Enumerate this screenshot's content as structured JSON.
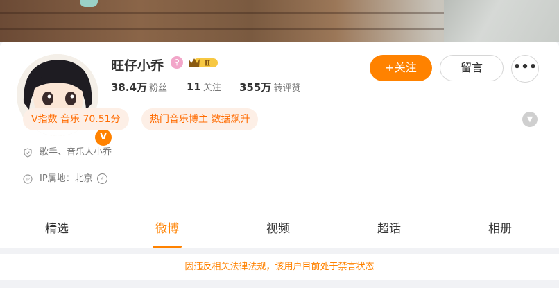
{
  "profile": {
    "name": "旺仔小乔",
    "verified_badge": "V",
    "member_level": "Ⅱ",
    "stats": [
      {
        "value": "38.4万",
        "label": "粉丝"
      },
      {
        "value": "11",
        "label": "关注"
      },
      {
        "value": "355万",
        "label": "转评赞"
      }
    ]
  },
  "actions": {
    "follow_label": "+关注",
    "message_label": "留言",
    "more_label": "•••"
  },
  "tags": [
    {
      "text": "V指数 音乐 70.51分"
    },
    {
      "text": "热门音乐博主 数据飙升"
    }
  ],
  "info": {
    "bio": "歌手、音乐人小乔",
    "ip_location": "IP属地：北京",
    "help_glyph": "?"
  },
  "tabs": [
    {
      "label": "精选"
    },
    {
      "label": "微博"
    },
    {
      "label": "视频"
    },
    {
      "label": "超话"
    },
    {
      "label": "相册"
    }
  ],
  "active_tab": "微博",
  "notice": "因违反相关法律法规，该用户目前处于禁言状态",
  "colors": {
    "accent": "#ff8200",
    "tag_bg": "#fdefe6",
    "tag_text": "#ff6b00",
    "notice_text": "#ff8200"
  },
  "icons": {
    "expand": "chevron-down-icon",
    "bio": "shield-icon",
    "ip": "ip-location-icon",
    "name_badge": "pink-lollipop-icon",
    "member": "crown-badge-icon"
  }
}
